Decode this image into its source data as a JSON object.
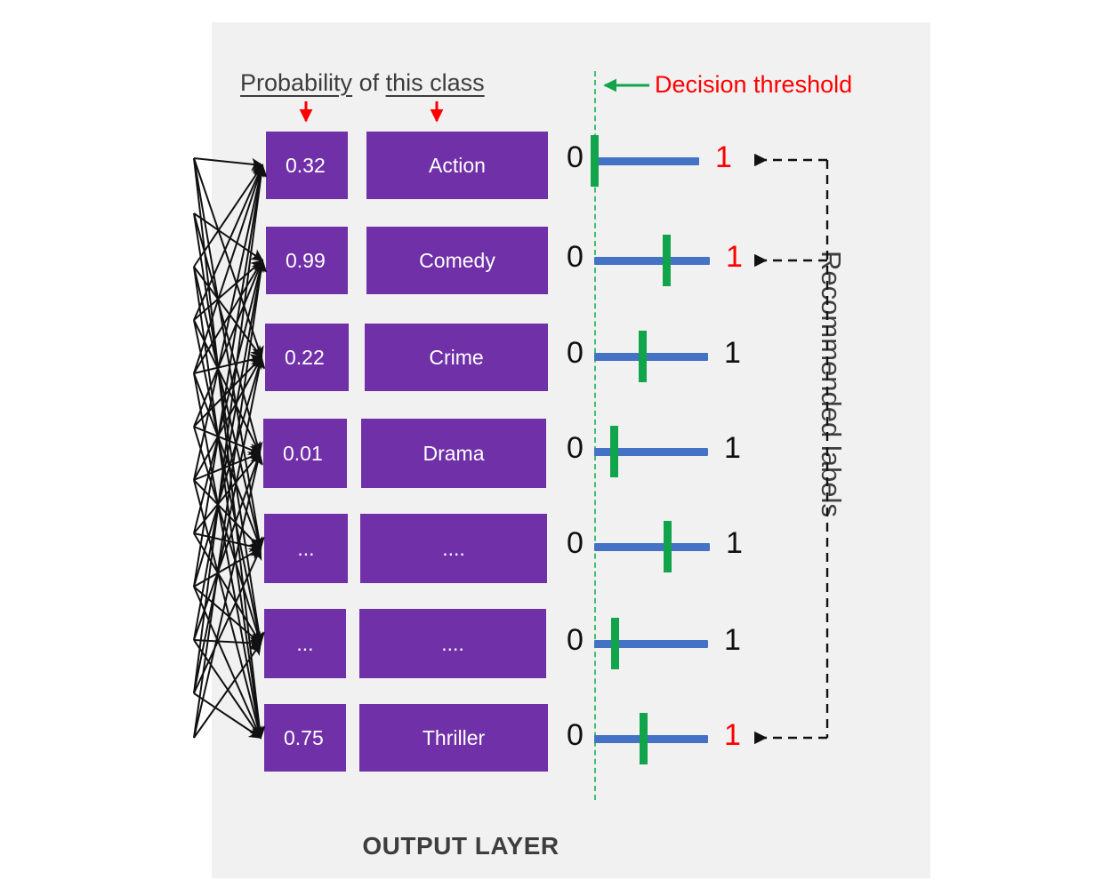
{
  "panel": {
    "background": "#f1f1f1",
    "caption": "OUTPUT LAYER"
  },
  "colors": {
    "box_purple": "#7030A8",
    "track_blue": "#4472C4",
    "marker_green": "#12A44B",
    "threshold_green": "#3FBF6F",
    "accent_red": "#ff0000",
    "text_dark": "#3d3d3d"
  },
  "header": {
    "part1": "Probability",
    "part2": " of ",
    "part3": "this class",
    "arrow_prob_name": "red-down-arrow",
    "arrow_class_name": "red-down-arrow"
  },
  "threshold": {
    "label": "Decision threshold",
    "line_style": "dash-dot",
    "value": 0.05
  },
  "bracket": {
    "label": "Recommended labels"
  },
  "rows": [
    {
      "probability": "0.32",
      "class": "Action",
      "left_label": "0",
      "right_label": "1",
      "recommended": true,
      "marker_pos": 0.0,
      "track_len": 118
    },
    {
      "probability": "0.99",
      "class": "Comedy",
      "left_label": "0",
      "right_label": "1",
      "recommended": true,
      "marker_pos": 0.62,
      "track_len": 130
    },
    {
      "probability": "0.22",
      "class": "Crime",
      "left_label": "0",
      "right_label": "1",
      "recommended": false,
      "marker_pos": 0.42,
      "track_len": 128
    },
    {
      "probability": "0.01",
      "class": "Drama",
      "left_label": "0",
      "right_label": "1",
      "recommended": false,
      "marker_pos": 0.17,
      "track_len": 128
    },
    {
      "probability": "...",
      "class": "....",
      "left_label": "0",
      "right_label": "1",
      "recommended": false,
      "marker_pos": 0.63,
      "track_len": 130
    },
    {
      "probability": "...",
      "class": "....",
      "left_label": "0",
      "right_label": "1",
      "recommended": false,
      "marker_pos": 0.18,
      "track_len": 128
    },
    {
      "probability": "0.75",
      "class": "Thriller",
      "left_label": "0",
      "right_label": "1",
      "recommended": true,
      "marker_pos": 0.43,
      "track_len": 128
    }
  ],
  "chart_data": {
    "type": "bar",
    "title": "Multi-label output layer probabilities",
    "categories": [
      "Action",
      "Comedy",
      "Crime",
      "Drama",
      "...",
      "....",
      "Thriller"
    ],
    "values": [
      0.32,
      0.99,
      0.22,
      0.01,
      null,
      null,
      0.75
    ],
    "xlabel": "",
    "ylabel": "Probability",
    "ylim": [
      0,
      1
    ],
    "threshold": 0.05,
    "recommended": [
      "Action",
      "Comedy",
      "Thriller"
    ]
  }
}
